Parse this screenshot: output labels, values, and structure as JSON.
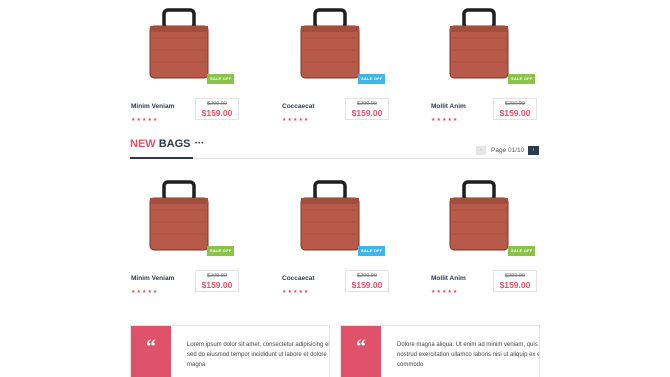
{
  "product_rows": [
    {
      "products": [
        {
          "name": "Minim Veniam",
          "old_price": "$200.00",
          "price": "$159.00",
          "badge": "SALE OFF",
          "badge_color": "green",
          "stars": "★★★★★"
        },
        {
          "name": "Coccaecat",
          "old_price": "$200.00",
          "price": "$159.00",
          "badge": "SALE OFF",
          "badge_color": "blue",
          "stars": "★★★★★"
        },
        {
          "name": "Mollit Anim",
          "old_price": "$200.00",
          "price": "$159.00",
          "badge": "SALE OFF",
          "badge_color": "green",
          "stars": "★★★★★"
        }
      ]
    },
    {
      "products": [
        {
          "name": "Minim Veniam",
          "old_price": "$200.00",
          "price": "$159.00",
          "badge": "SALE OFF",
          "badge_color": "green",
          "stars": "★★★★★"
        },
        {
          "name": "Coccaecat",
          "old_price": "$200.00",
          "price": "$159.00",
          "badge": "SALE OFF",
          "badge_color": "blue",
          "stars": "★★★★★"
        },
        {
          "name": "Mollit Anim",
          "old_price": "$200.00",
          "price": "$159.00",
          "badge": "SALE OFF",
          "badge_color": "green",
          "stars": "★★★★★"
        }
      ]
    }
  ],
  "section": {
    "title_highlight": "NEW",
    "title_rest": "BAGS",
    "dots": "•••",
    "pagination": {
      "prev_icon": "chevron-left-icon",
      "next_icon": "chevron-right-icon",
      "prev_glyph": "‹",
      "next_glyph": "›",
      "page_text": "Page 01/10"
    }
  },
  "testimonials": [
    {
      "quote_glyph": "“",
      "text": "Lorem ipsum dolor sit amet, consectetur adipisicing elit, sed do eiusmod tempor incididunt ut labore et dolore magna"
    },
    {
      "quote_glyph": "“",
      "text": "Dolore magna aliqua. Ut enim ad minim veniam, quis nostrud exercitation ullamco laboris nisi ut aliquip ex ea commodo"
    }
  ],
  "colors": {
    "accent": "#e0526a",
    "dark": "#2c3a4d",
    "sale_green": "#8bc34a",
    "sale_blue": "#3fb6e6",
    "bag": "#b85a4a"
  }
}
